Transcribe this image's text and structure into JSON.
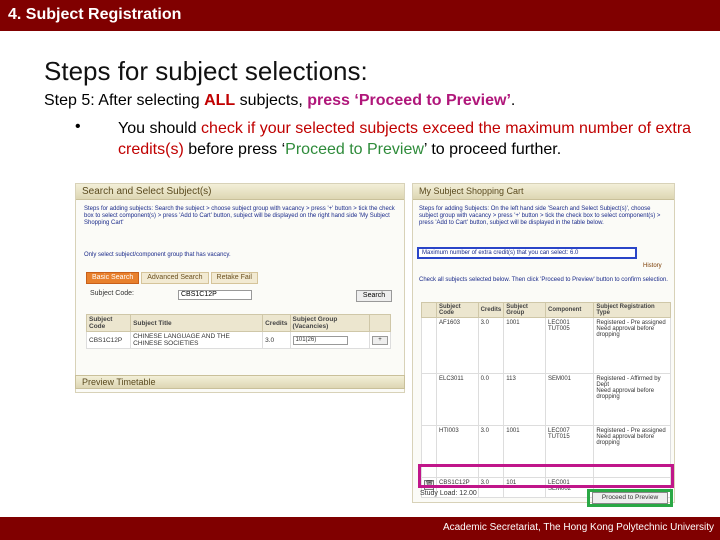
{
  "slide": {
    "section_title": "4. Subject Registration",
    "heading": "Steps for subject selections:",
    "step": {
      "prefix": "Step 5: After selecting ",
      "all": "ALL",
      "middle": " subjects, ",
      "press": "press ‘Proceed to Preview’",
      "suffix": "."
    },
    "bullet": {
      "symbol": "•",
      "t1": "You should ",
      "t2": "check if your selected subjects exceed the maximum number of extra credits(s)",
      "t3": " before press ‘",
      "t4": "Proceed to Preview",
      "t5": "’ to proceed further."
    },
    "footer": "Academic Secretariat, The Hong Kong Polytechnic University",
    "colors": {
      "bar": "#800000",
      "highlight_red": "#c00000",
      "highlight_pink": "#b0167a",
      "highlight_green": "#2e8b3a",
      "box_blue": "#2a45c8",
      "box_magenta": "#c0168a",
      "box_green": "#2aa845"
    }
  },
  "left_panel": {
    "title": "Search and Select Subject(s)",
    "steps_text": "Steps for adding subjects: Search the subject > choose subject group with vacancy > press '+' button > tick the check box to select component(s) > press 'Add to Cart' button, subject will be displayed on the right hand side 'My Subject Shopping Cart'",
    "only_select": "Only select subject/component group that has vacancy.",
    "tabs": [
      {
        "label": "Basic Search"
      },
      {
        "label": "Advanced Search"
      },
      {
        "label": "Retake Fail"
      }
    ],
    "subject_code_label": "Subject Code:",
    "subject_code_value": "CBS1C12P",
    "search_label": "Search",
    "table": {
      "headers": [
        "Subject Code",
        "Subject Title",
        "Credits",
        "Subject Group (Vacancies)",
        ""
      ],
      "row": {
        "code": "CBS1C12P",
        "title": "CHINESE LANGUAGE AND THE CHINESE SOCIETIES",
        "credits": "3.0",
        "group": "101(26)",
        "btn": "+"
      }
    },
    "preview_title": "Preview Timetable"
  },
  "right_panel": {
    "title": "My Subject Shopping Cart",
    "steps_text": "Steps for adding Subjects: On the left hand side 'Search and Select Subject(s)', choose subject group with vacancy > press '+' button > tick the check box to select component(s) > press 'Add to Cart' button, subject will be displayed in the table below.",
    "max_credits": "Maximum number of extra credit(s) that you can select: 6.0",
    "history": "History",
    "check_note": "Check all subjects selected below. Then click 'Proceed to Preview' button to confirm selection.",
    "headers": [
      "",
      "Subject Code",
      "Credits",
      "Subject Group",
      "Component",
      "Subject Registration Type"
    ],
    "rows": [
      {
        "icon": "",
        "code": "AF1603",
        "credits": "3.0",
        "group": "1001",
        "component": "LEC001 TUT005",
        "type": "Registered - Pre assigned\nNeed approval before dropping"
      },
      {
        "icon": "",
        "code": "ELC3011",
        "credits": "0.0",
        "group": "113",
        "component": "SEM001",
        "type": "Registered - Affirmed by Dept\nNeed approval before dropping"
      },
      {
        "icon": "",
        "code": "HTI003",
        "credits": "3.0",
        "group": "1001",
        "component": "LEC007 TUT015",
        "type": "Registered - Pre assigned\nNeed approval before dropping"
      },
      {
        "icon": "🗑",
        "code": "CBS1C12P",
        "credits": "3.0",
        "group": "101",
        "component": "LEC001 SEM002",
        "type": ""
      }
    ],
    "study_load": "Study Load: 12.00",
    "proceed_label": "Proceed to Preview"
  }
}
